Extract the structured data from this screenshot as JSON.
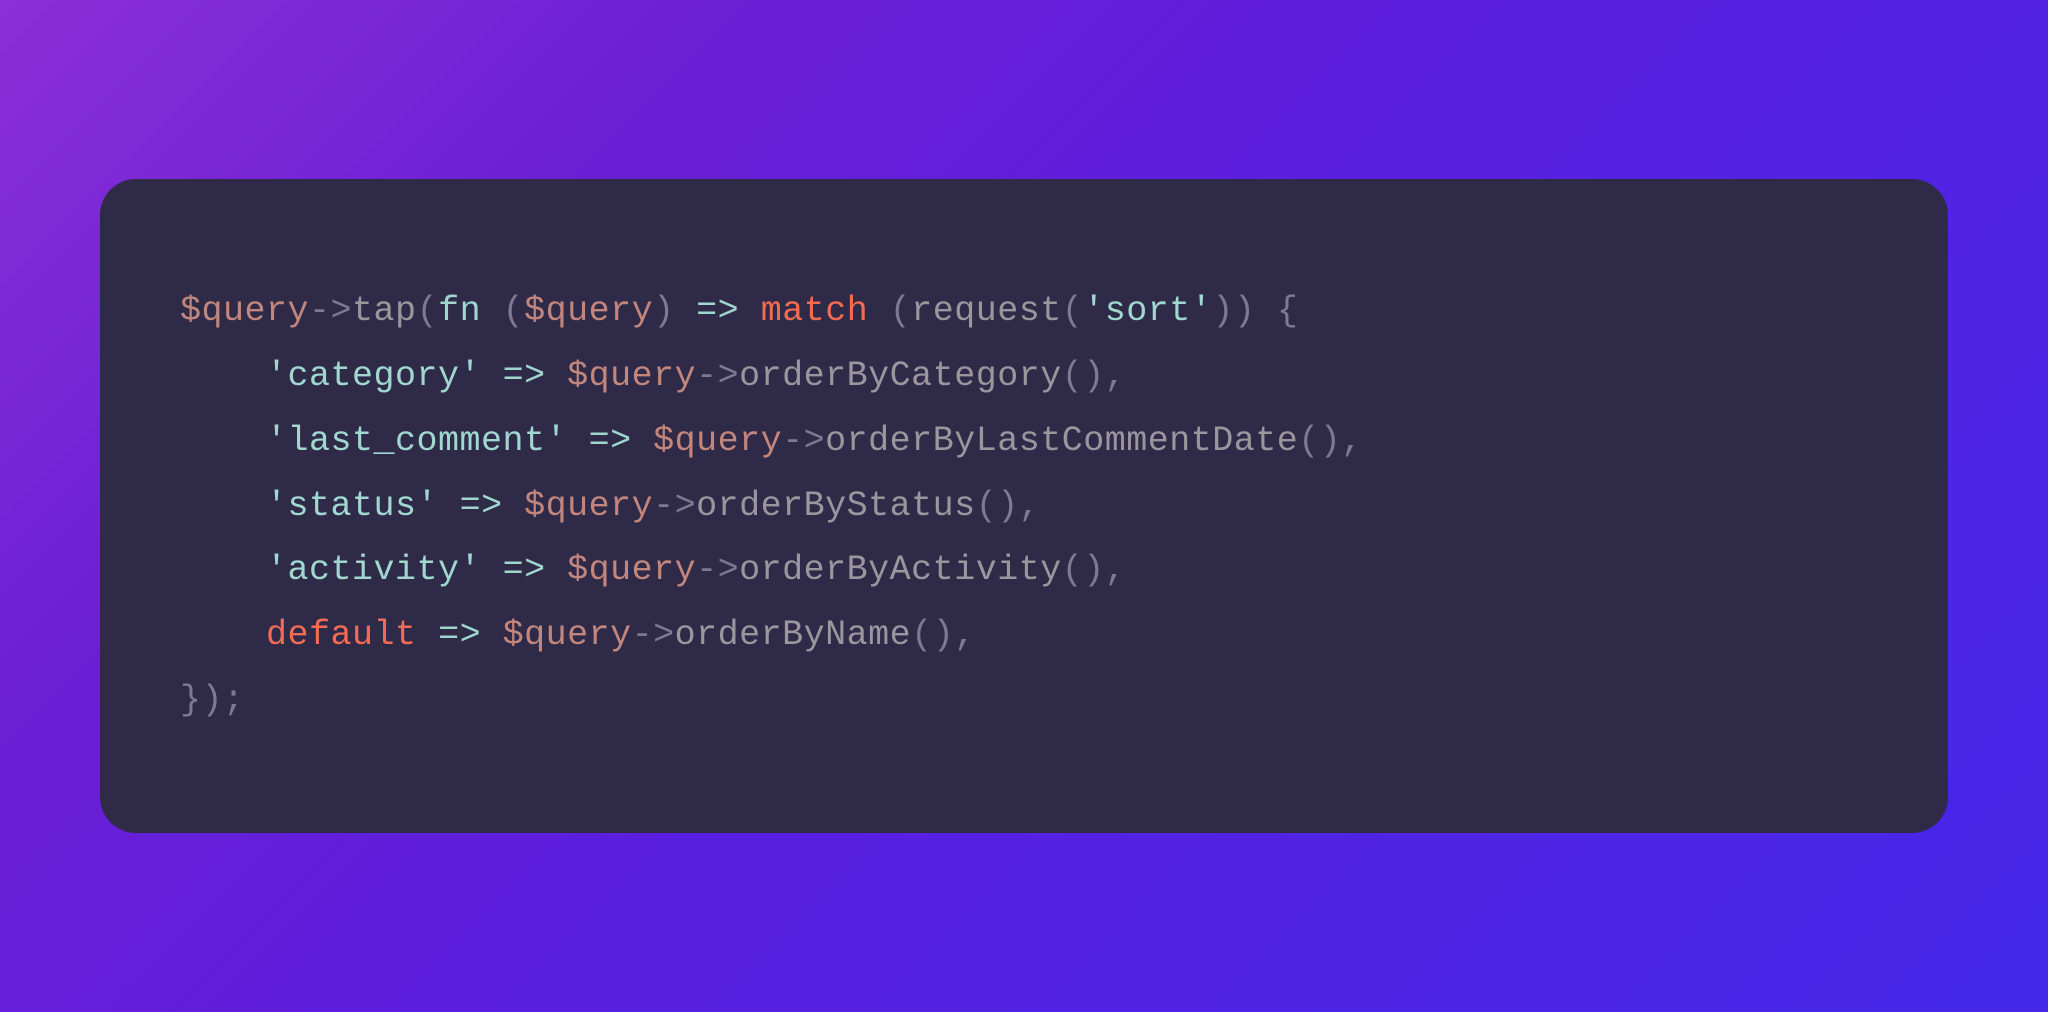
{
  "code": {
    "line1": {
      "var1": "$query",
      "arrow1": "->",
      "tap": "tap",
      "p1": "(",
      "fn": "fn",
      "p2": " (",
      "var2": "$query",
      "p3": ") ",
      "fat": "=>",
      "sp1": " ",
      "match": "match",
      "p4": " (",
      "request": "request",
      "p5": "(",
      "str1": "'sort'",
      "p6": ")) {"
    },
    "line2": {
      "indent": "    ",
      "str": "'category'",
      "sp1": " ",
      "fat": "=>",
      "sp2": " ",
      "var": "$query",
      "arrow": "->",
      "method": "orderByCategory",
      "p": "(),"
    },
    "line3": {
      "indent": "    ",
      "str": "'last_comment'",
      "sp1": " ",
      "fat": "=>",
      "sp2": " ",
      "var": "$query",
      "arrow": "->",
      "method": "orderByLastCommentDate",
      "p": "(),"
    },
    "line4": {
      "indent": "    ",
      "str": "'status'",
      "sp1": " ",
      "fat": "=>",
      "sp2": " ",
      "var": "$query",
      "arrow": "->",
      "method": "orderByStatus",
      "p": "(),"
    },
    "line5": {
      "indent": "    ",
      "str": "'activity'",
      "sp1": " ",
      "fat": "=>",
      "sp2": " ",
      "var": "$query",
      "arrow": "->",
      "method": "orderByActivity",
      "p": "(),"
    },
    "line6": {
      "indent": "    ",
      "default": "default",
      "sp1": " ",
      "fat": "=>",
      "sp2": " ",
      "var": "$query",
      "arrow": "->",
      "method": "orderByName",
      "p": "(),"
    },
    "line7": {
      "close": "});"
    }
  },
  "colors": {
    "bg_gradient_start": "#8b2fd9",
    "bg_gradient_end": "#4528e8",
    "code_bg": "#2e2a48",
    "variable": "#c3867c",
    "keyword_orange": "#f26b52",
    "string_teal": "#a0d7cf",
    "method": "#99969e",
    "punct": "#7e7990"
  }
}
